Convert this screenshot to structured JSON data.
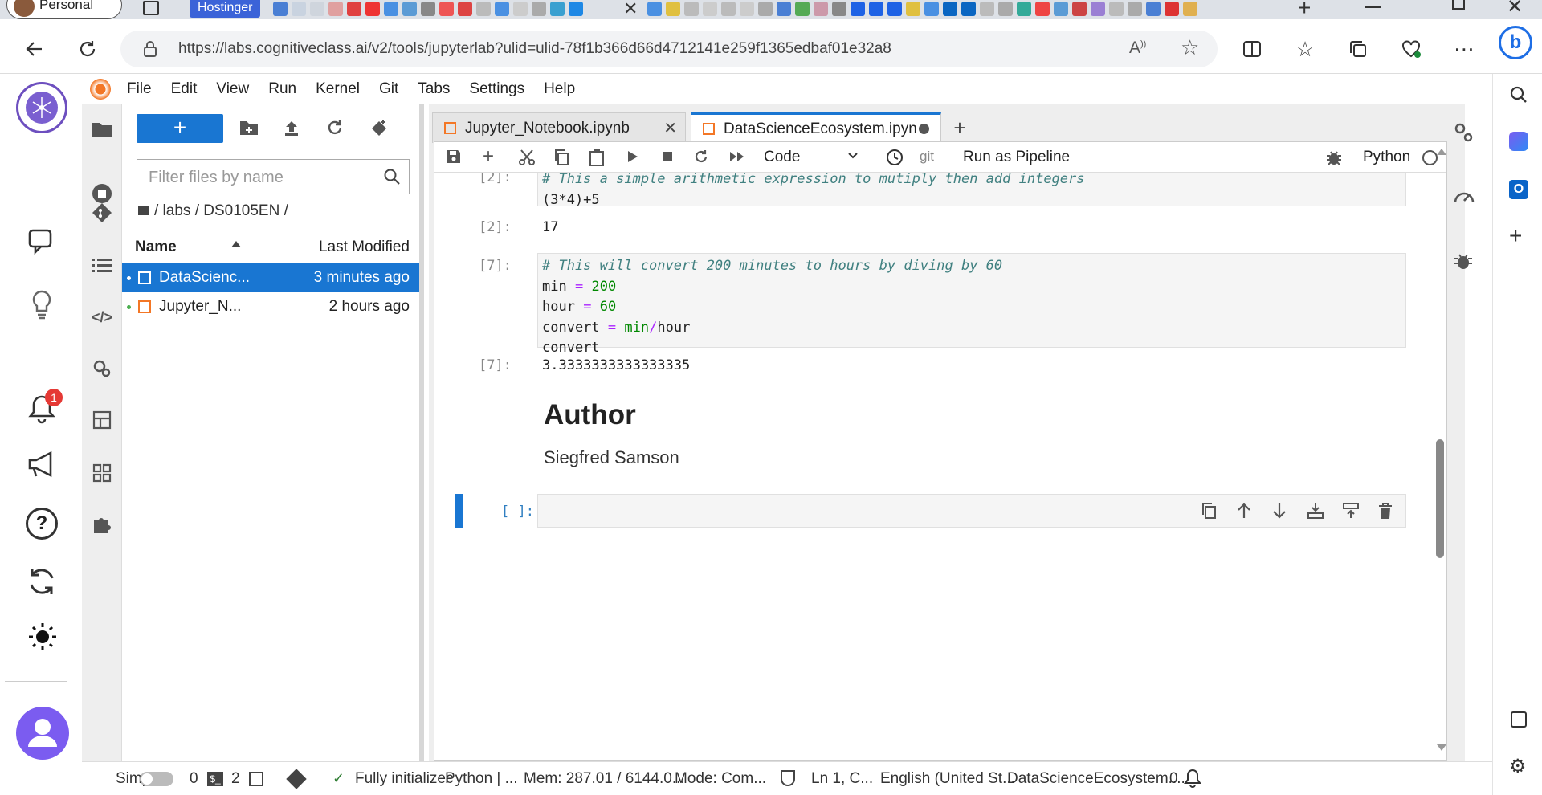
{
  "browser": {
    "profile_label": "Personal",
    "pinned_tab_label": "Hostinger",
    "url": "https://labs.cognitiveclass.ai/v2/tools/jupyterlab?ulid=ulid-78f1b366d66d4712141e259f1365edbaf01e32a8"
  },
  "menu": [
    "File",
    "Edit",
    "View",
    "Run",
    "Kernel",
    "Git",
    "Tabs",
    "Settings",
    "Help"
  ],
  "notifications": {
    "badge_count": "1"
  },
  "file_browser": {
    "filter_placeholder": "Filter files by name",
    "breadcrumb": "/ labs / DS0105EN /",
    "col_name": "Name",
    "col_modified": "Last Modified",
    "files": [
      {
        "name": "DataScienc...",
        "modified": "3 minutes ago",
        "selected": true
      },
      {
        "name": "Jupyter_N...",
        "modified": "2 hours ago",
        "selected": false
      }
    ]
  },
  "notebook_tabs": [
    {
      "title": "Jupyter_Notebook.ipynb"
    },
    {
      "title": "DataScienceEcosystem.ipyn"
    }
  ],
  "toolbar": {
    "cell_type": "Code",
    "git_label": "git",
    "pipeline_label": "Run as Pipeline",
    "kernel_name": "Python"
  },
  "cells": {
    "c1_prompt": "[2]:",
    "c1_line1": "# This a simple arithmetic expression to mutiply then add integers",
    "c1_line2": "(3*4)+5",
    "o1_prompt": "[2]:",
    "o1_value": "17",
    "c2_prompt": "[7]:",
    "c2_comment": "# This will convert 200 minutes to hours by diving by 60",
    "c2_min_var": "min",
    "c2_min_val": "200",
    "c2_hour_var": "hour",
    "c2_hour_val": "60",
    "c2_convert_var": "convert",
    "c2_expr_a": "min",
    "c2_expr_b": "hour",
    "c2_last": "convert",
    "o2_prompt": "[7]:",
    "o2_value": "3.3333333333333335",
    "md_heading": "Author",
    "md_text": "Siegfred Samson",
    "empty_prompt": "[ ]:"
  },
  "status": {
    "mode": "Simple",
    "terminals": "0",
    "kernels": "2",
    "kernel_status": "Fully initializec",
    "kernel_short": "Python | ...",
    "memory": "Mem: 287.01 / 6144.0...",
    "edit_mode": "Mode: Com...",
    "cursor": "Ln 1, C...",
    "language": "English (United St...",
    "filename": "DataScienceEcosystem....",
    "notif_count": "0"
  }
}
